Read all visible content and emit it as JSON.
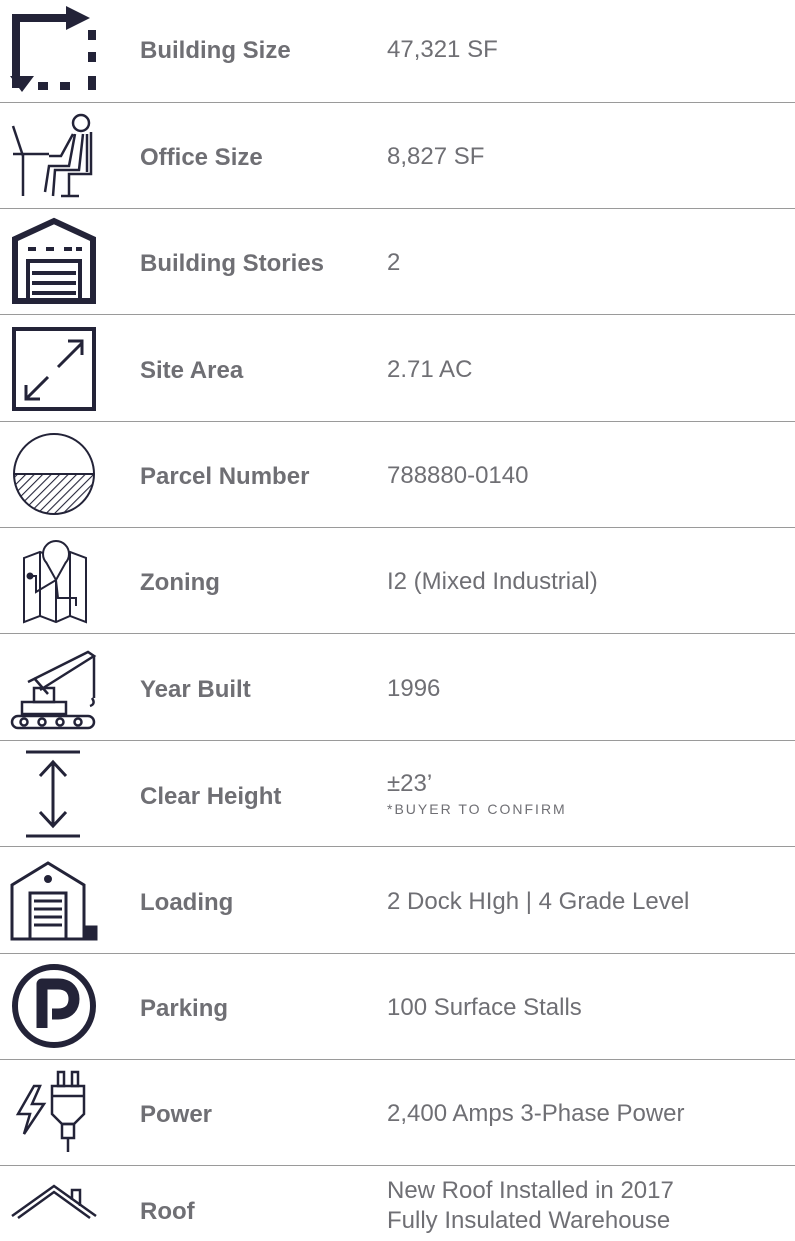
{
  "colors": {
    "icon": "#232338",
    "text": "#6f6f74",
    "divider": "#9a9a9a"
  },
  "specs": [
    {
      "icon": "building-size-icon",
      "label": "Building Size",
      "value": "47,321 SF"
    },
    {
      "icon": "office-desk-person-icon",
      "label": "Office Size",
      "value": "8,827 SF"
    },
    {
      "icon": "warehouse-stories-icon",
      "label": "Building Stories",
      "value": "2"
    },
    {
      "icon": "diagonal-arrows-icon",
      "label": "Site Area",
      "value": "2.71 AC"
    },
    {
      "icon": "parcel-circle-icon",
      "label": "Parcel Number",
      "value": "788880-0140"
    },
    {
      "icon": "map-pin-icon",
      "label": "Zoning",
      "value": "I2 (Mixed Industrial)"
    },
    {
      "icon": "crane-icon",
      "label": "Year Built",
      "value": "1996"
    },
    {
      "icon": "vertical-height-icon",
      "label": "Clear Height",
      "value": "±23’",
      "note": "*BUYER TO CONFIRM"
    },
    {
      "icon": "loading-dock-icon",
      "label": "Loading",
      "value": "2 Dock HIgh | 4 Grade Level"
    },
    {
      "icon": "parking-icon",
      "label": "Parking",
      "value": "100 Surface Stalls"
    },
    {
      "icon": "power-plug-icon",
      "label": "Power",
      "value": "2,400 Amps 3-Phase Power"
    },
    {
      "icon": "roof-icon",
      "label": "Roof",
      "value_line1": "New Roof Installed in 2017",
      "value_line2": "Fully Insulated Warehouse"
    }
  ]
}
